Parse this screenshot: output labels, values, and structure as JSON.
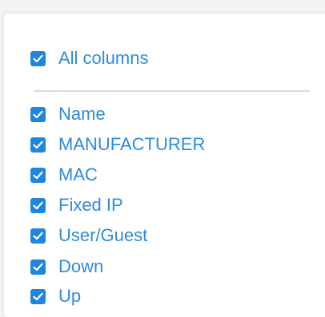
{
  "all_columns": {
    "label": "All columns",
    "checked": true
  },
  "columns": [
    {
      "label": "Name",
      "checked": true
    },
    {
      "label": "MANUFACTURER",
      "checked": true
    },
    {
      "label": "MAC",
      "checked": true
    },
    {
      "label": "Fixed IP",
      "checked": true
    },
    {
      "label": "User/Guest",
      "checked": true
    },
    {
      "label": "Down",
      "checked": true
    },
    {
      "label": "Up",
      "checked": true
    }
  ],
  "colors": {
    "accent": "#1f86e0",
    "label": "#2d8be0",
    "divider": "#d9d9d9"
  },
  "icons": {
    "checkbox": "check-icon"
  }
}
